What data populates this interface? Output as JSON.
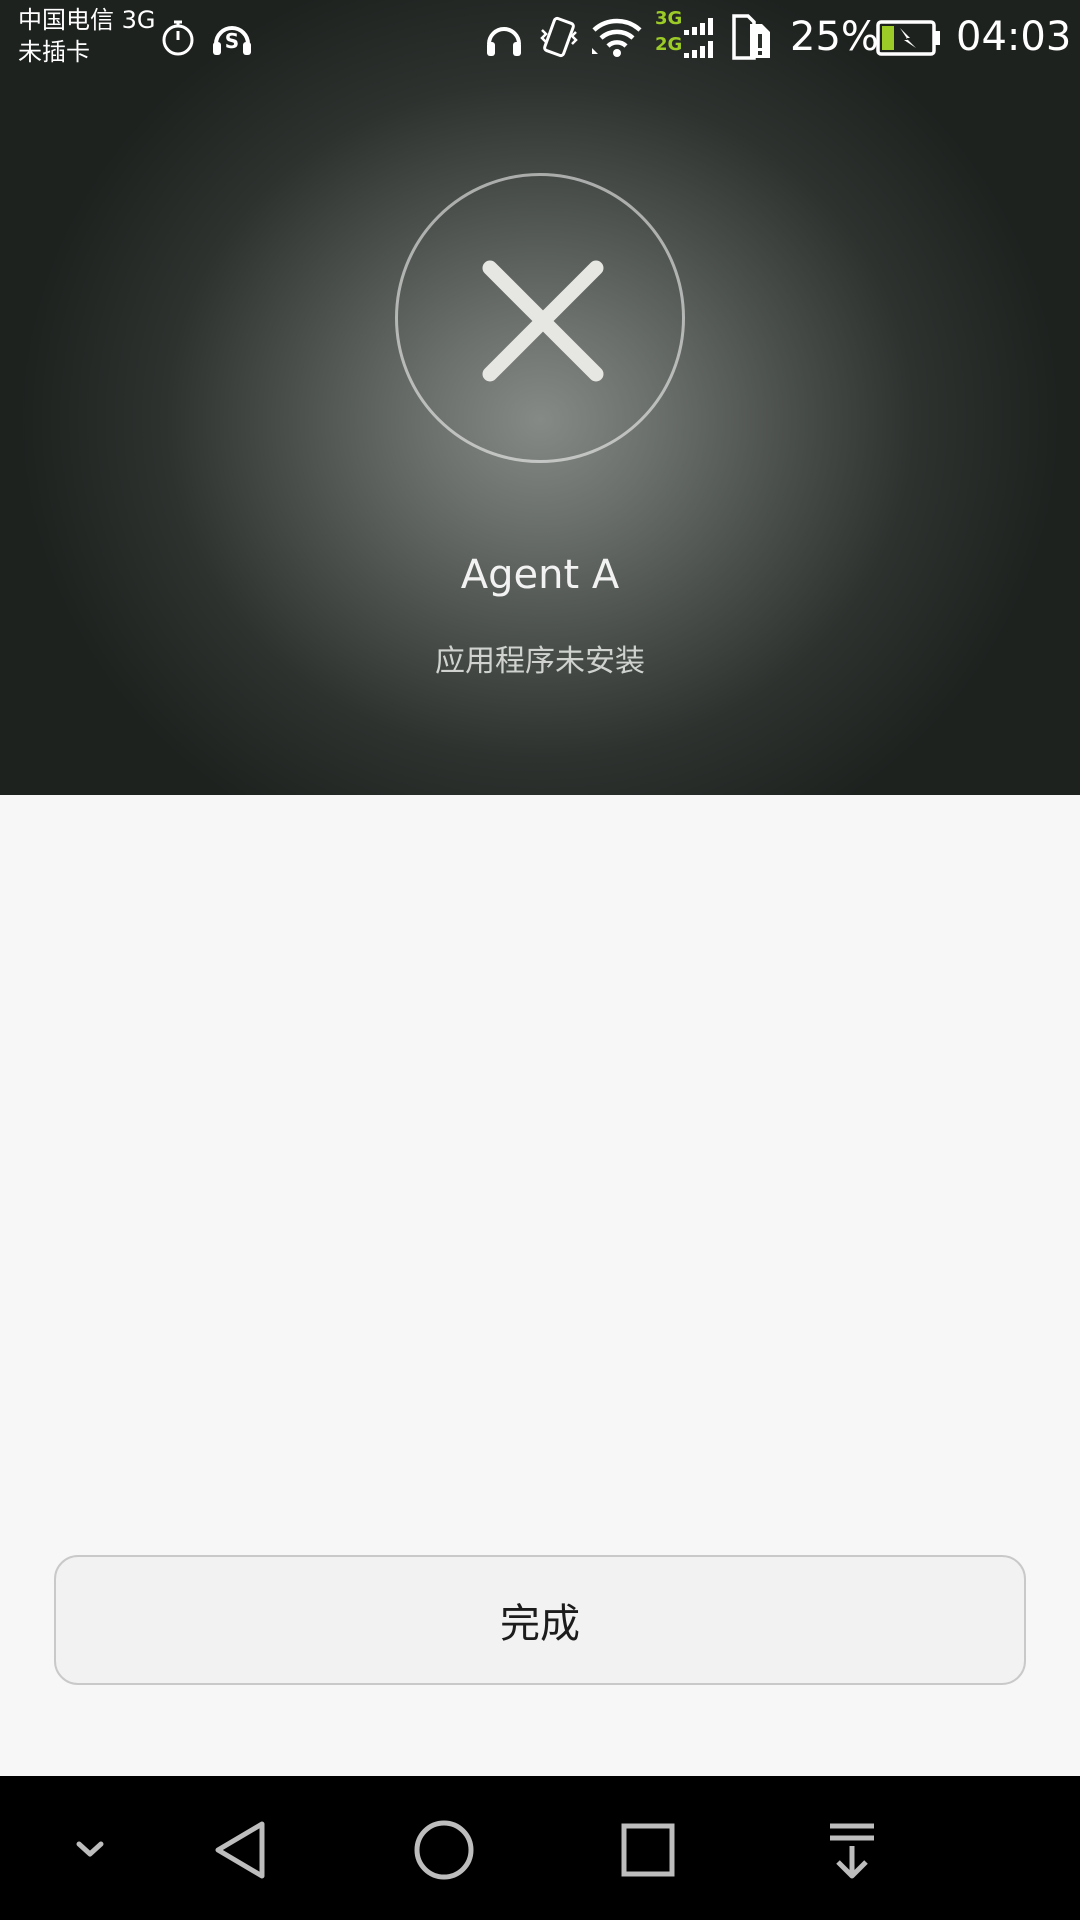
{
  "status_bar": {
    "carrier_line1": "中国电信 3G",
    "carrier_line2": "未插卡",
    "net_type_top": "3G",
    "net_type_bottom": "2G",
    "battery_percent": "25%",
    "battery_level": 25,
    "time": "04:03",
    "icons": [
      "stopwatch-icon",
      "s-headset-icon",
      "headphones-icon",
      "vibrate-icon",
      "wifi-icon",
      "signal-icon",
      "sim-alert-icon",
      "battery-charging-icon"
    ],
    "accent_color": "#9ccb27"
  },
  "result": {
    "icon": "close-icon",
    "app_name": "Agent A",
    "message": "应用程序未安装"
  },
  "actions": {
    "done_label": "完成"
  },
  "nav_bar": {
    "buttons": [
      "collapse-icon",
      "back-icon",
      "home-icon",
      "recents-icon",
      "notification-pull-icon"
    ]
  }
}
